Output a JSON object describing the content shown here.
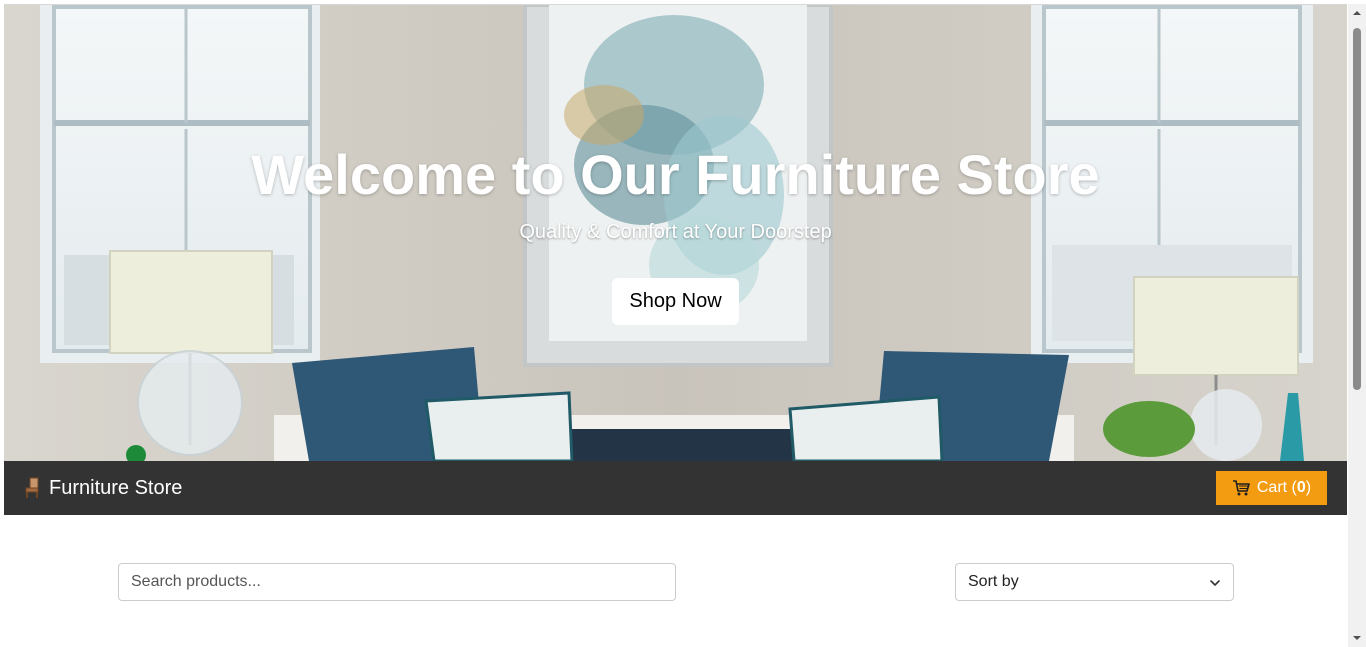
{
  "hero": {
    "title": "Welcome to Our Furniture Store",
    "subtitle": "Quality & Comfort at Your Doorstep",
    "cta_label": "Shop Now",
    "image": "living-room-photo"
  },
  "navbar": {
    "brand_icon": "chair-icon",
    "brand_name": "Furniture Store",
    "cart_icon": "shopping-cart-icon",
    "cart_label": "Cart (",
    "cart_count": "0",
    "cart_suffix": ")"
  },
  "toolbar": {
    "search_placeholder": "Search products...",
    "sort_label": "Sort by",
    "sort_icon": "chevron-down-icon"
  },
  "colors": {
    "navbar_bg": "#333333",
    "cart_bg": "#f39c12",
    "hero_text": "#ffffff"
  }
}
